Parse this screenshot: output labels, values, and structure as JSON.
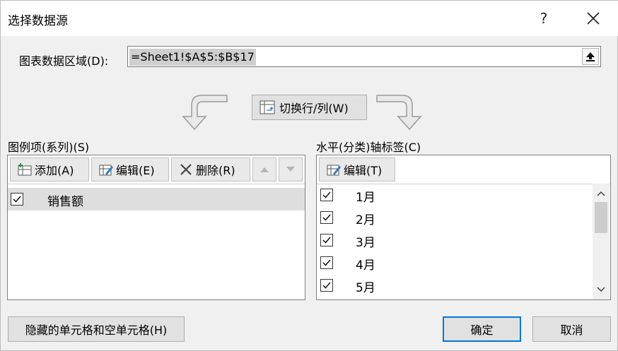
{
  "dialog": {
    "title": "选择数据源",
    "help": "?",
    "close": "✕"
  },
  "range": {
    "label": "图表数据区域(D):",
    "value": "=Sheet1!$A$5:$B$17"
  },
  "switch_label": "切换行/列(W)",
  "legend": {
    "label": "图例项(系列)(S)",
    "add": "添加(A)",
    "edit": "编辑(E)",
    "delete": "删除(R)",
    "items": [
      {
        "label": "销售额",
        "checked": true
      }
    ]
  },
  "axis": {
    "label": "水平(分类)轴标签(C)",
    "edit": "编辑(T)",
    "items": [
      {
        "label": "1月",
        "checked": true
      },
      {
        "label": "2月",
        "checked": true
      },
      {
        "label": "3月",
        "checked": true
      },
      {
        "label": "4月",
        "checked": true
      },
      {
        "label": "5月",
        "checked": true
      }
    ]
  },
  "buttons": {
    "hidden_cells": "隐藏的单元格和空单元格(H)",
    "ok": "确定",
    "cancel": "取消"
  }
}
